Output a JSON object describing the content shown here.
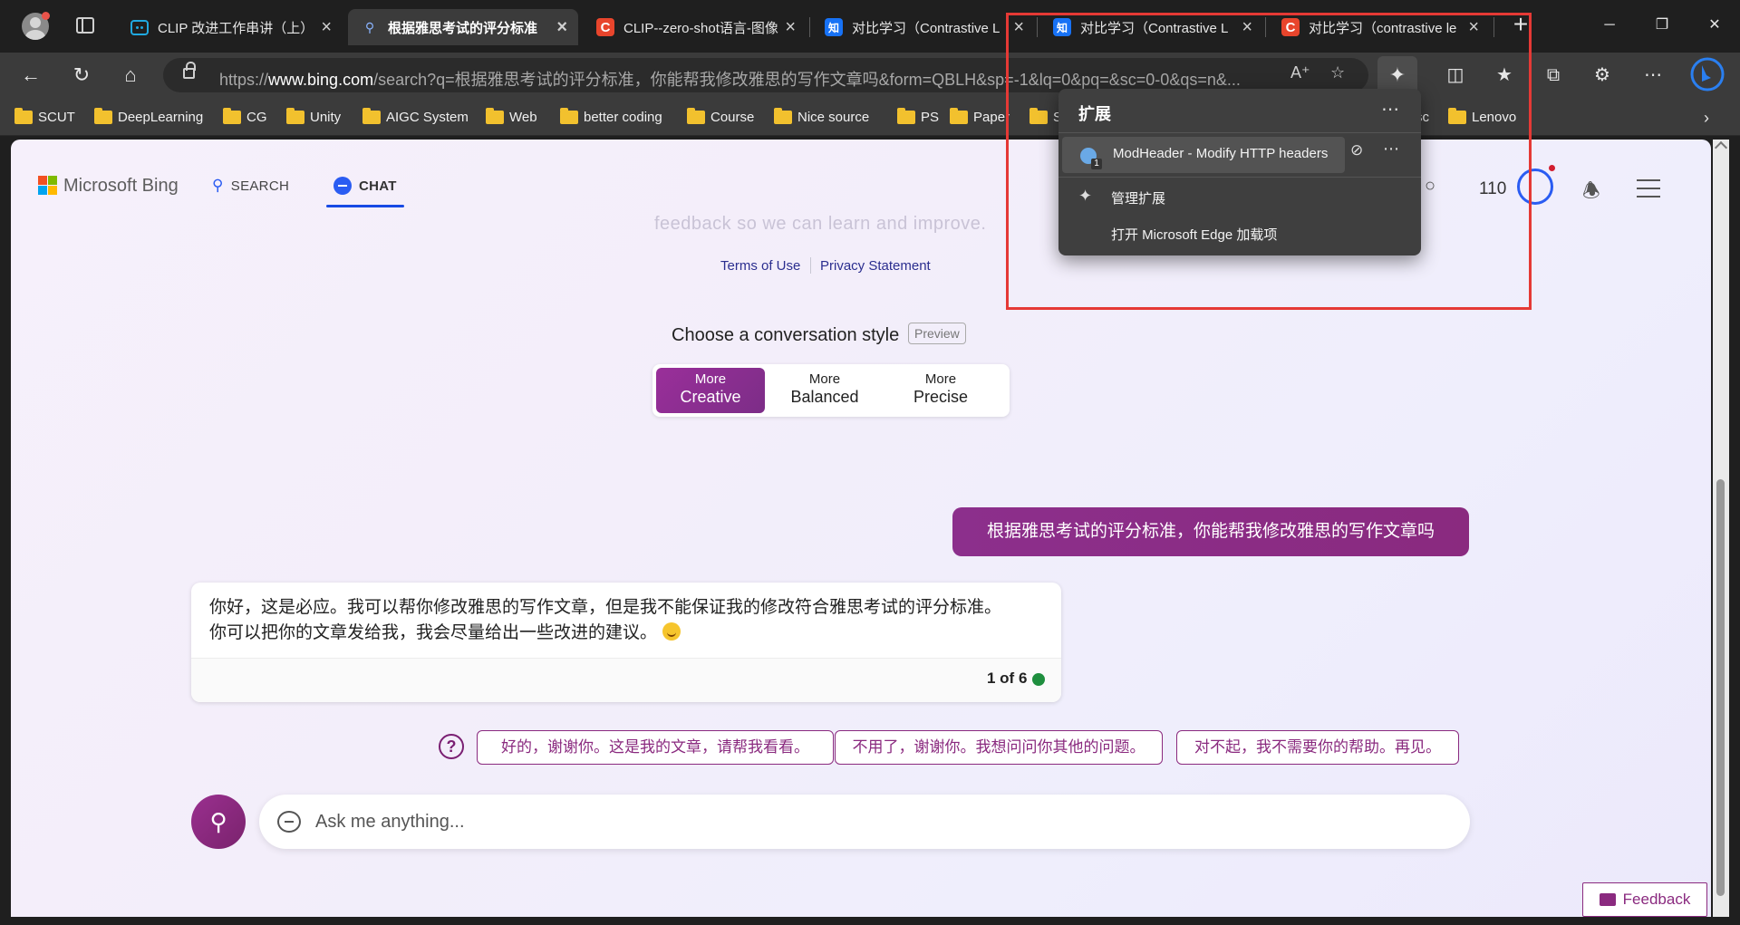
{
  "window": {
    "tabs": [
      {
        "title": "CLIP 改进工作串讲（上）",
        "favicon": "bilibili-icon",
        "active": false
      },
      {
        "title": "根据雅思考试的评分标准",
        "favicon": "search-icon",
        "active": true
      },
      {
        "title": "CLIP--zero-shot语言-图像",
        "favicon": "csdn-icon",
        "active": false
      },
      {
        "title": "对比学习（Contrastive L",
        "favicon": "zhihu-icon",
        "active": false
      },
      {
        "title": "对比学习（Contrastive L",
        "favicon": "zhihu-icon",
        "active": false
      },
      {
        "title": "对比学习（contrastive le",
        "favicon": "csdn-icon",
        "active": false
      }
    ],
    "new_tab_label": "+",
    "minimize": "─",
    "maximize": "❐",
    "close": "✕"
  },
  "address_bar": {
    "url_prefix": "https://",
    "url_host": "www.bing.com",
    "url_rest": "/search?q=根据雅思考试的评分标准，你能帮我修改雅思的写作文章吗&form=QBLH&sp=-1&lq=0&pq=&sc=0-0&qs=n&..."
  },
  "bookmarks": [
    {
      "label": "SCUT"
    },
    {
      "label": "DeepLearning"
    },
    {
      "label": "CG"
    },
    {
      "label": "Unity"
    },
    {
      "label": "AIGC System"
    },
    {
      "label": "Web"
    },
    {
      "label": "better coding"
    },
    {
      "label": "Course"
    },
    {
      "label": "Nice source"
    },
    {
      "label": "PS"
    },
    {
      "label": "Paper"
    },
    {
      "label": "S"
    },
    {
      "label": "sc"
    },
    {
      "label": "Lenovo"
    }
  ],
  "bing": {
    "brand": "Microsoft Bing",
    "nav_search": "SEARCH",
    "nav_chat": "CHAT",
    "points": "110",
    "faded_text": "feedback so we can learn and improve.",
    "terms": "Terms of Use",
    "privacy": "Privacy Statement",
    "style_title": "Choose a conversation style",
    "preview": "Preview",
    "styles": [
      {
        "top": "More",
        "bottom": "Creative",
        "selected": true
      },
      {
        "top": "More",
        "bottom": "Balanced",
        "selected": false
      },
      {
        "top": "More",
        "bottom": "Precise",
        "selected": false
      }
    ],
    "user_message": "根据雅思考试的评分标准，你能帮我修改雅思的写作文章吗",
    "bot_message_line1": "你好，这是必应。我可以帮你修改雅思的写作文章，但是我不能保证我的修改符合雅思考试的评分标准。",
    "bot_message_line2": "你可以把你的文章发给我，我会尽量给出一些改进的建议。",
    "counter": "1 of 6",
    "suggestions": [
      "好的，谢谢你。这是我的文章，请帮我看看。",
      "不用了，谢谢你。我想问问你其他的问题。",
      "对不起，我不需要你的帮助。再见。"
    ],
    "ask_placeholder": "Ask me anything...",
    "feedback": "Feedback"
  },
  "extensions_popup": {
    "title": "扩展",
    "item_label": "ModHeader - Modify HTTP headers",
    "item_badge": "1",
    "manage": "管理扩展",
    "open_addons": "打开 Microsoft Edge 加载项"
  },
  "colors": {
    "accent_purple": "#8a2a7f",
    "bing_blue": "#174ae4",
    "highlight_red": "#e53935"
  }
}
